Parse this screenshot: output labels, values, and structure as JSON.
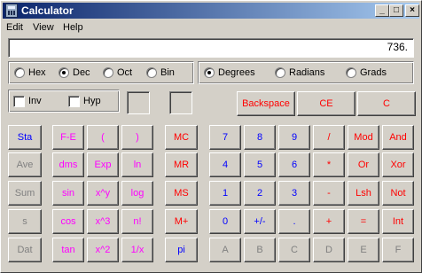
{
  "window": {
    "title": "Calculator",
    "controls": [
      "_",
      "□",
      "×"
    ]
  },
  "menubar": {
    "edit_label": "Edit",
    "view_label": "View",
    "help_label": "Help"
  },
  "display": {
    "value": "736."
  },
  "base": {
    "hex": "Hex",
    "dec": "Dec",
    "oct": "Oct",
    "bin": "Bin",
    "selected": "Dec"
  },
  "angle": {
    "degrees": "Degrees",
    "radians": "Radians",
    "grads": "Grads",
    "selected": "Degrees"
  },
  "options": {
    "inv": "Inv",
    "hyp": "Hyp"
  },
  "buttons": {
    "backspace": "Backspace",
    "ce": "CE",
    "c": "C",
    "sta": "Sta",
    "ave": "Ave",
    "sum": "Sum",
    "s": "s",
    "dat": "Dat",
    "fe": "F-E",
    "lparen": "(",
    "rparen": ")",
    "dms": "dms",
    "exp": "Exp",
    "ln": "ln",
    "sin": "sin",
    "xpowy": "x^y",
    "log": "log",
    "cos": "cos",
    "xcube": "x^3",
    "fact": "n!",
    "tan": "tan",
    "xsq": "x^2",
    "recip": "1/x",
    "mc": "MC",
    "mr": "MR",
    "ms": "MS",
    "mplus": "M+",
    "pi": "pi",
    "n7": "7",
    "n8": "8",
    "n9": "9",
    "div": "/",
    "mod": "Mod",
    "and": "And",
    "n4": "4",
    "n5": "5",
    "n6": "6",
    "mul": "*",
    "or": "Or",
    "xor": "Xor",
    "n1": "1",
    "n2": "2",
    "n3": "3",
    "sub": "-",
    "lsh": "Lsh",
    "not": "Not",
    "n0": "0",
    "sign": "+/-",
    "dot": ".",
    "add": "+",
    "eq": "=",
    "int": "Int",
    "a": "A",
    "b": "B",
    "c_hex": "C",
    "d": "D",
    "e": "E",
    "f": "F"
  },
  "colors": {
    "title_start": "#0a246a",
    "title_end": "#a6caf0",
    "face": "#d4d0c8",
    "blue": "#0000ff",
    "red": "#ff0000",
    "magenta": "#ff00ff",
    "disabled": "#808080"
  }
}
